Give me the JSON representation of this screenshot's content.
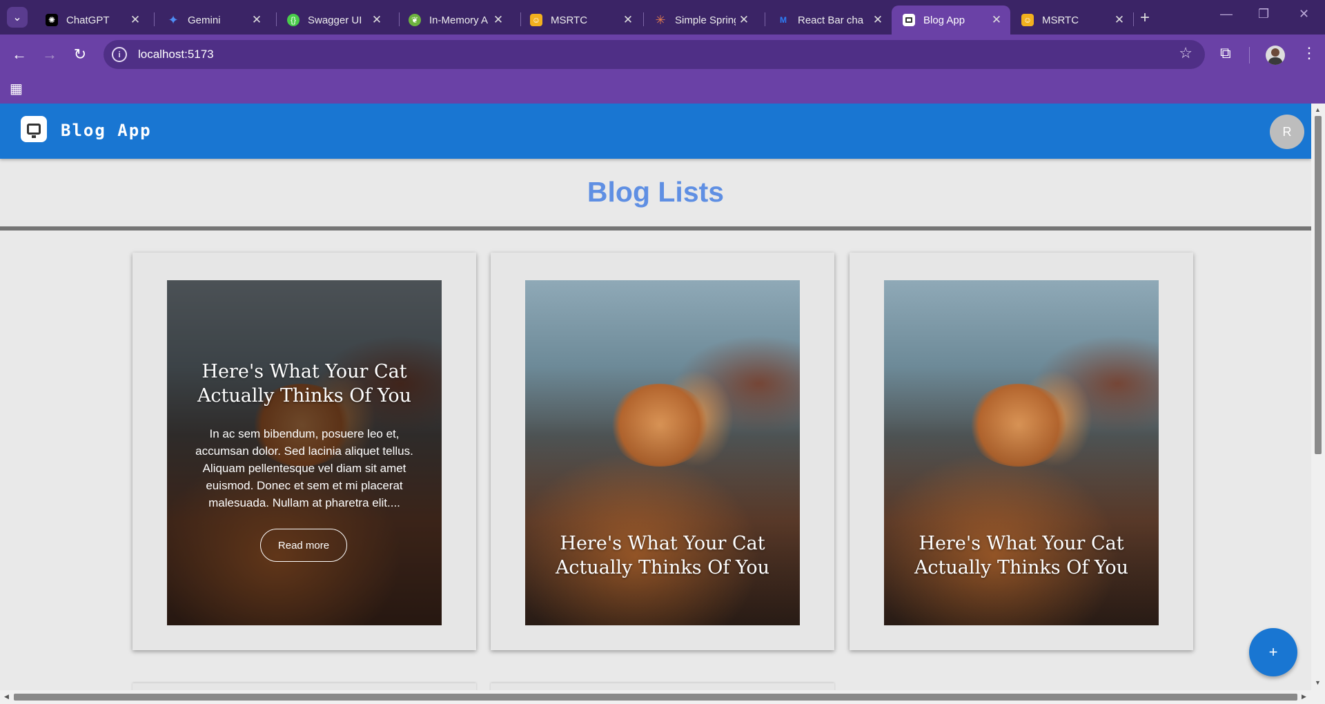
{
  "browser": {
    "tabs": [
      {
        "title": "ChatGPT",
        "icon": "chatgpt-icon",
        "color": "#000000"
      },
      {
        "title": "Gemini",
        "icon": "gemini-icon",
        "color": "#4f8df5"
      },
      {
        "title": "Swagger UI",
        "icon": "swagger-icon",
        "color": "#49cc4a"
      },
      {
        "title": "In-Memory A",
        "icon": "spring-icon",
        "color": "#6db33f"
      },
      {
        "title": "MSRTC",
        "icon": "msrtc-icon",
        "color": "#f2b01e"
      },
      {
        "title": "Simple Spring",
        "icon": "claude-icon",
        "color": "#e07a4f"
      },
      {
        "title": "React Bar cha",
        "icon": "mui-icon",
        "color": "#2d7ff9"
      },
      {
        "title": "Blog App",
        "icon": "blog-app-icon",
        "color": "#ffffff"
      },
      {
        "title": "MSRTC",
        "icon": "msrtc-icon",
        "color": "#f2b01e"
      }
    ],
    "active_tab_index": 7,
    "url": "localhost:5173",
    "new_tab_symbol": "+",
    "close_symbol": "✕"
  },
  "app": {
    "brand": "Blog App",
    "user_initial": "R",
    "page_title": "Blog Lists",
    "accent_color": "#1976d2",
    "title_color": "#5f8fe3"
  },
  "posts": [
    {
      "title": "Here's What Your Cat Actually Thinks Of You",
      "excerpt": "In ac sem bibendum, posuere leo et, accumsan dolor. Sed lacinia aliquet tellus. Aliquam pellentesque vel diam sit amet euismod. Donec et sem et mi placerat malesuada. Nullam at pharetra elit....",
      "read_more": "Read more"
    },
    {
      "title": "Here's What Your Cat Actually Thinks Of You"
    },
    {
      "title": "Here's What Your Cat Actually Thinks Of You"
    }
  ],
  "fab": {
    "symbol": "+"
  }
}
